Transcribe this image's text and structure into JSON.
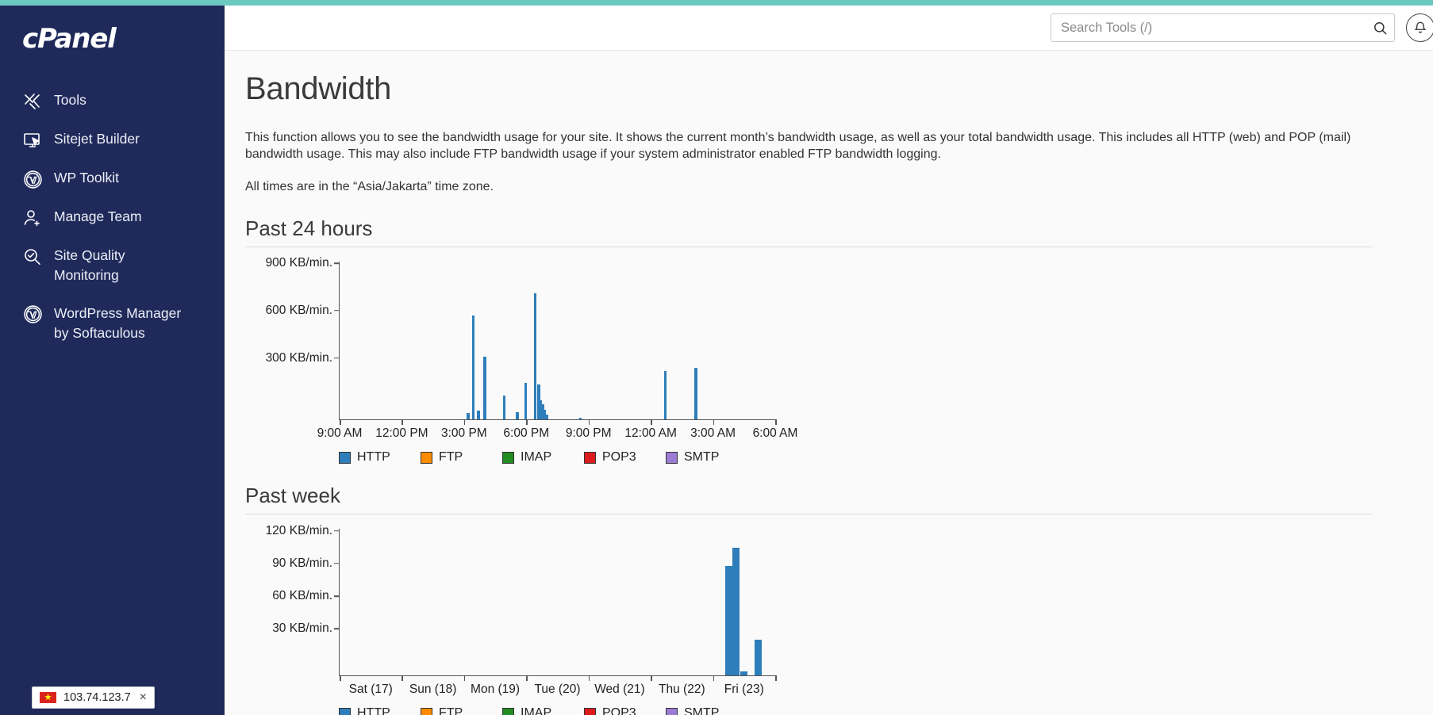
{
  "brand": {
    "logo_text": "cPanel",
    "accent_color": "#6cc9c0",
    "sidebar_color": "#1f2a5a"
  },
  "sidebar": {
    "items": [
      {
        "label": "Tools",
        "icon": "tools-icon"
      },
      {
        "label": "Sitejet Builder",
        "icon": "monitor-cursor-icon"
      },
      {
        "label": "WP Toolkit",
        "icon": "wordpress-icon"
      },
      {
        "label": "Manage Team",
        "icon": "user-plus-icon"
      },
      {
        "label": "Site Quality\nMonitoring",
        "icon": "magnifier-check-icon"
      },
      {
        "label": "WordPress Manager\nby Softaculous",
        "icon": "wordpress-icon"
      }
    ],
    "ip_chip": {
      "ip": "103.74.123.7",
      "flag": "vietnam-flag-icon",
      "close": "×"
    }
  },
  "topbar": {
    "search": {
      "placeholder": "Search Tools (/)",
      "value": "",
      "icon": "search-icon"
    },
    "notifications_icon": "bell-icon"
  },
  "page": {
    "title": "Bandwidth",
    "description": "This function allows you to see the bandwidth usage for your site. It shows the current month’s bandwidth usage, as well as your total bandwidth usage. This includes all HTTP (web) and POP (mail) bandwidth usage. This may also include FTP bandwidth usage if your system administrator enabled FTP bandwidth logging.",
    "timezone_note": "All times are in the “Asia/Jakarta” time zone."
  },
  "legend": [
    {
      "label": "HTTP",
      "color": "#2e7ebb"
    },
    {
      "label": "FTP",
      "color": "#ff8c00"
    },
    {
      "label": "IMAP",
      "color": "#228b22"
    },
    {
      "label": "POP3",
      "color": "#dc1c1c"
    },
    {
      "label": "SMTP",
      "color": "#9b7bd4"
    }
  ],
  "chart_data": [
    {
      "type": "bar",
      "title": "Past 24 hours",
      "xlabel": "",
      "ylabel": "KB/min.",
      "ylim": [
        0,
        1000
      ],
      "yticks": [
        300,
        600,
        900
      ],
      "ytick_labels": [
        "300 KB/min.",
        "600 KB/min.",
        "900 KB/min."
      ],
      "xtick_labels": [
        "9:00 AM",
        "12:00 PM",
        "3:00 PM",
        "6:00 PM",
        "9:00 PM",
        "12:00 AM",
        "3:00 AM",
        "6:00 AM"
      ],
      "grid": false,
      "legend_position": "bottom",
      "series": [
        {
          "name": "HTTP",
          "color": "#2e7ebb",
          "points": [
            {
              "x": 29.2,
              "y": 40
            },
            {
              "x": 30.4,
              "y": 660
            },
            {
              "x": 31.6,
              "y": 55
            },
            {
              "x": 33.0,
              "y": 400
            },
            {
              "x": 37.5,
              "y": 150
            },
            {
              "x": 40.5,
              "y": 45
            },
            {
              "x": 42.4,
              "y": 230
            },
            {
              "x": 44.6,
              "y": 800
            },
            {
              "x": 45.4,
              "y": 220
            },
            {
              "x": 45.9,
              "y": 120
            },
            {
              "x": 46.3,
              "y": 95
            },
            {
              "x": 46.8,
              "y": 60
            },
            {
              "x": 47.3,
              "y": 30
            },
            {
              "x": 55.0,
              "y": 12
            },
            {
              "x": 74.5,
              "y": 310
            },
            {
              "x": 81.5,
              "y": 330
            }
          ]
        },
        {
          "name": "FTP",
          "color": "#ff8c00",
          "points": []
        },
        {
          "name": "IMAP",
          "color": "#228b22",
          "points": []
        },
        {
          "name": "POP3",
          "color": "#dc1c1c",
          "points": []
        },
        {
          "name": "SMTP",
          "color": "#9b7bd4",
          "points": []
        }
      ]
    },
    {
      "type": "bar",
      "title": "Past week",
      "xlabel": "",
      "ylabel": "KB/min.",
      "ylim": [
        0,
        135
      ],
      "yticks": [
        30,
        60,
        90,
        120
      ],
      "ytick_labels": [
        "30 KB/min.",
        "60 KB/min.",
        "90 KB/min.",
        "120 KB/min."
      ],
      "xtick_labels": [
        "Sat (17)",
        "Sun (18)",
        "Mon (19)",
        "Tue (20)",
        "Wed (21)",
        "Thu (22)",
        "Fri (23)"
      ],
      "grid": false,
      "legend_position": "bottom",
      "series": [
        {
          "name": "HTTP",
          "color": "#2e7ebb",
          "points": [
            {
              "x": 88.5,
              "y": 101
            },
            {
              "x": 90.2,
              "y": 118
            },
            {
              "x": 92.0,
              "y": 4
            },
            {
              "x": 95.3,
              "y": 33
            }
          ]
        },
        {
          "name": "FTP",
          "color": "#ff8c00",
          "points": []
        },
        {
          "name": "IMAP",
          "color": "#228b22",
          "points": []
        },
        {
          "name": "POP3",
          "color": "#dc1c1c",
          "points": []
        },
        {
          "name": "SMTP",
          "color": "#9b7bd4",
          "points": []
        }
      ]
    }
  ]
}
